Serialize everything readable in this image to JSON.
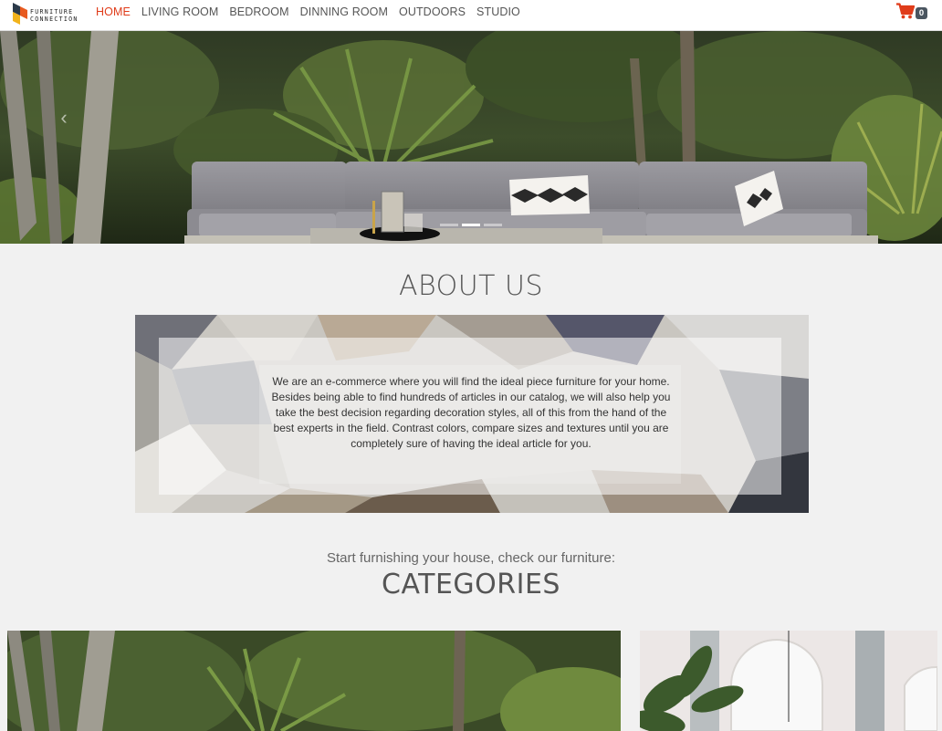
{
  "brand": {
    "name_line1": "FURNITURE",
    "name_line2": "CONNECTION"
  },
  "nav": {
    "items": [
      {
        "label": "HOME",
        "active": true
      },
      {
        "label": "LIVING ROOM",
        "active": false
      },
      {
        "label": "BEDROOM",
        "active": false
      },
      {
        "label": "DINNING ROOM",
        "active": false
      },
      {
        "label": "OUTDOORS",
        "active": false
      },
      {
        "label": "STUDIO",
        "active": false
      }
    ],
    "cart_count": "0",
    "cart_icon": "shopping-cart-icon"
  },
  "hero": {
    "slides_total": 3,
    "active_slide": 2
  },
  "about": {
    "title": "ABOUT US",
    "text": "We are an e-commerce where you will find the ideal piece furniture for your home. Besides being able to find hundreds of articles in our catalog, we will also help you take the best decision regarding decoration styles, all of this from the hand of the best experts in the field. Contrast colors, compare sizes and textures until you are completely sure of having the ideal article for you."
  },
  "categories": {
    "subtitle": "Start furnishing your house, check our furniture:",
    "title": "CATEGORIES"
  },
  "colors": {
    "accent": "#e03c1a",
    "badge": "#4a5560",
    "background": "#f1f1f1"
  }
}
